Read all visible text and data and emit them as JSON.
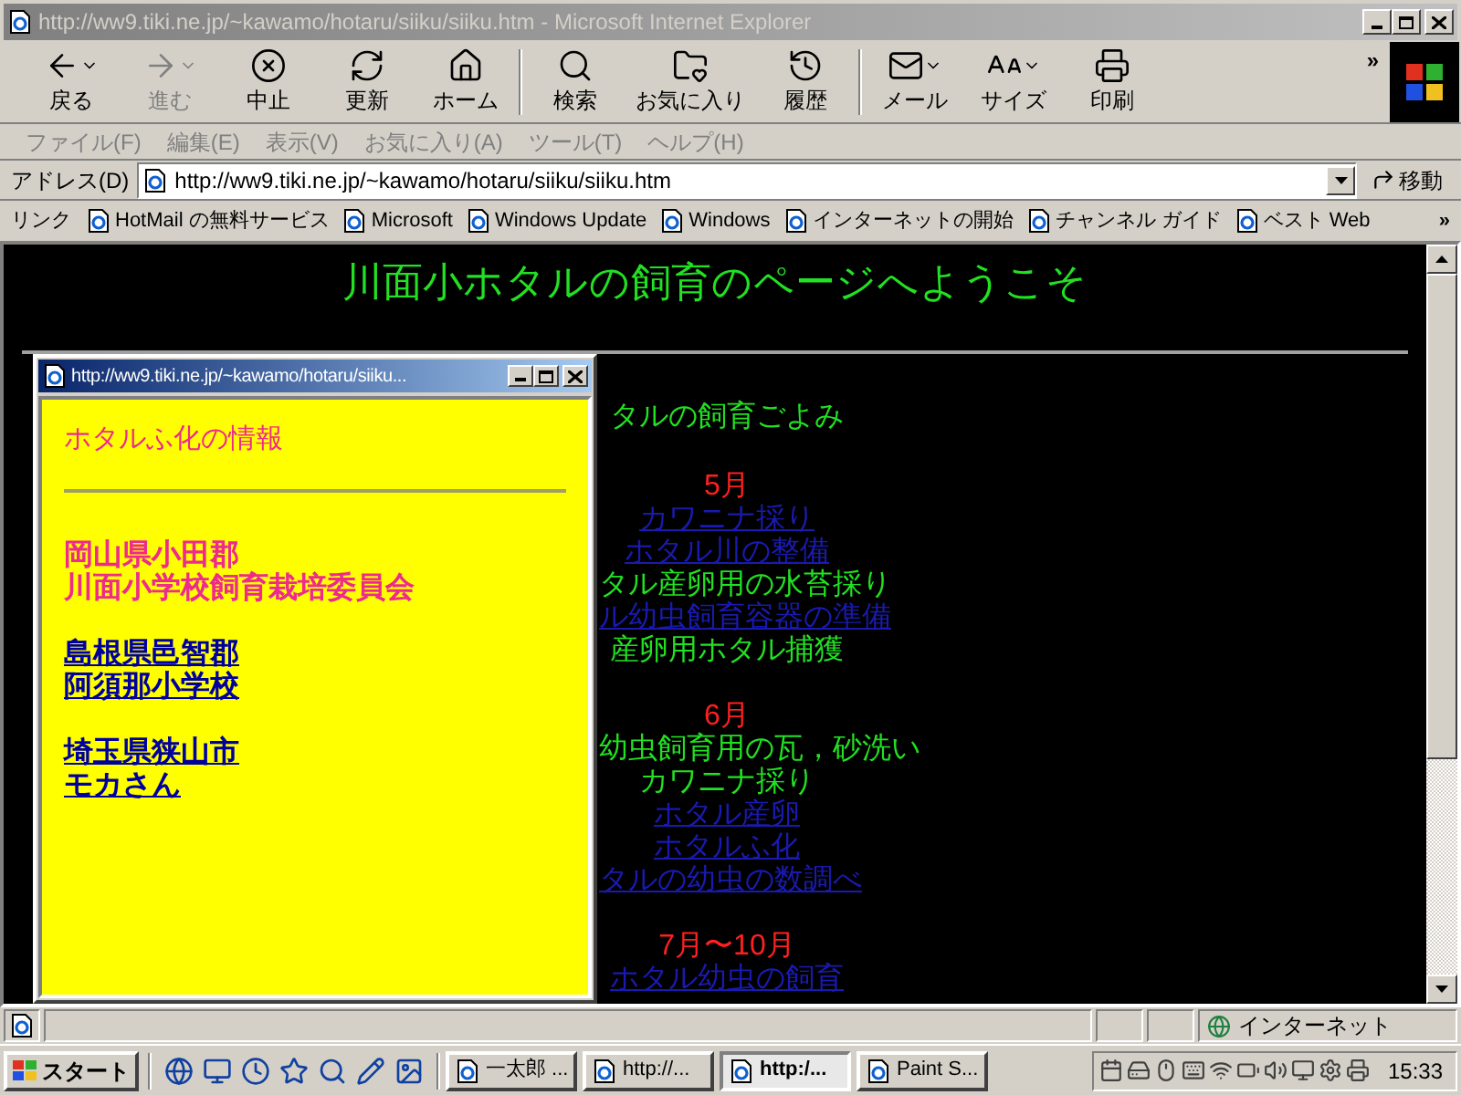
{
  "window": {
    "title": "http://ww9.tiki.ne.jp/~kawamo/hotaru/siiku/siiku.htm - Microsoft Internet Explorer"
  },
  "toolbar": [
    {
      "label": "戻る",
      "has_menu": true,
      "disabled": false
    },
    {
      "label": "進む",
      "has_menu": true,
      "disabled": true
    },
    {
      "label": "中止",
      "has_menu": false,
      "disabled": false
    },
    {
      "label": "更新",
      "has_menu": false,
      "disabled": false
    },
    {
      "label": "ホーム",
      "has_menu": false,
      "disabled": false
    },
    {
      "label": "検索",
      "has_menu": false,
      "disabled": false
    },
    {
      "label": "お気に入り",
      "has_menu": false,
      "disabled": false
    },
    {
      "label": "履歴",
      "has_menu": false,
      "disabled": false
    },
    {
      "label": "メール",
      "has_menu": true,
      "disabled": false
    },
    {
      "label": "サイズ",
      "has_menu": true,
      "disabled": false
    },
    {
      "label": "印刷",
      "has_menu": false,
      "disabled": false
    }
  ],
  "toolbar_more": "»",
  "menu": [
    {
      "label": "ファイル(F)",
      "disabled": true
    },
    {
      "label": "編集(E)",
      "disabled": true
    },
    {
      "label": "表示(V)",
      "disabled": true
    },
    {
      "label": "お気に入り(A)",
      "disabled": true
    },
    {
      "label": "ツール(T)",
      "disabled": true
    },
    {
      "label": "ヘルプ(H)",
      "disabled": true
    }
  ],
  "address": {
    "label": "アドレス(D)",
    "value": "http://ww9.tiki.ne.jp/~kawamo/hotaru/siiku/siiku.htm",
    "go": "移動"
  },
  "links": {
    "label": "リンク",
    "items": [
      "HotMail の無料サービス",
      "Microsoft",
      "Windows Update",
      "Windows",
      "インターネットの開始",
      "チャンネル ガイド",
      "ベスト Web"
    ],
    "more": "»"
  },
  "page": {
    "heading": "川面小ホタルの飼育のページへようこそ",
    "subtitle": "タルの飼育ごよみ",
    "sections": [
      {
        "month": "5月",
        "items": [
          {
            "text": "カワニナ採り",
            "kind": "link"
          },
          {
            "text": "ホタル川の整備",
            "kind": "link"
          },
          {
            "text": "タル産卵用の水苔採り",
            "kind": "text"
          },
          {
            "text": "ル幼虫飼育容器の準備",
            "kind": "link"
          },
          {
            "text": "産卵用ホタル捕獲",
            "kind": "text"
          }
        ]
      },
      {
        "month": "6月",
        "items": [
          {
            "text": "幼虫飼育用の瓦，砂洗い",
            "kind": "text"
          },
          {
            "text": "カワニナ採り",
            "kind": "text"
          },
          {
            "text": "ホタル産卵",
            "kind": "link"
          },
          {
            "text": "ホタルふ化",
            "kind": "link"
          },
          {
            "text": "タルの幼虫の数調べ",
            "kind": "link"
          }
        ]
      },
      {
        "month": "7月〜10月",
        "items": [
          {
            "text": "ホタル幼虫の飼育",
            "kind": "link"
          }
        ]
      }
    ]
  },
  "popup": {
    "title": "http://ww9.tiki.ne.jp/~kawamo/hotaru/siiku...",
    "heading": "ホタルふ化の情報",
    "groups": [
      {
        "kind": "text",
        "lines": [
          "岡山県小田郡",
          "川面小学校飼育栽培委員会"
        ]
      },
      {
        "kind": "link",
        "lines": [
          "島根県邑智郡",
          "阿須那小学校"
        ]
      },
      {
        "kind": "link",
        "lines": [
          "埼玉県狭山市",
          "モカさん"
        ]
      }
    ]
  },
  "status_bar": {
    "zone": "インターネット"
  },
  "taskbar": {
    "start": "スタート",
    "tasks": [
      {
        "label": "一太郎 ...",
        "selected": false
      },
      {
        "label": "http://...",
        "selected": false
      },
      {
        "label": "http:/...",
        "selected": true
      },
      {
        "label": "Paint S...",
        "selected": false
      }
    ],
    "clock": "15:33"
  }
}
